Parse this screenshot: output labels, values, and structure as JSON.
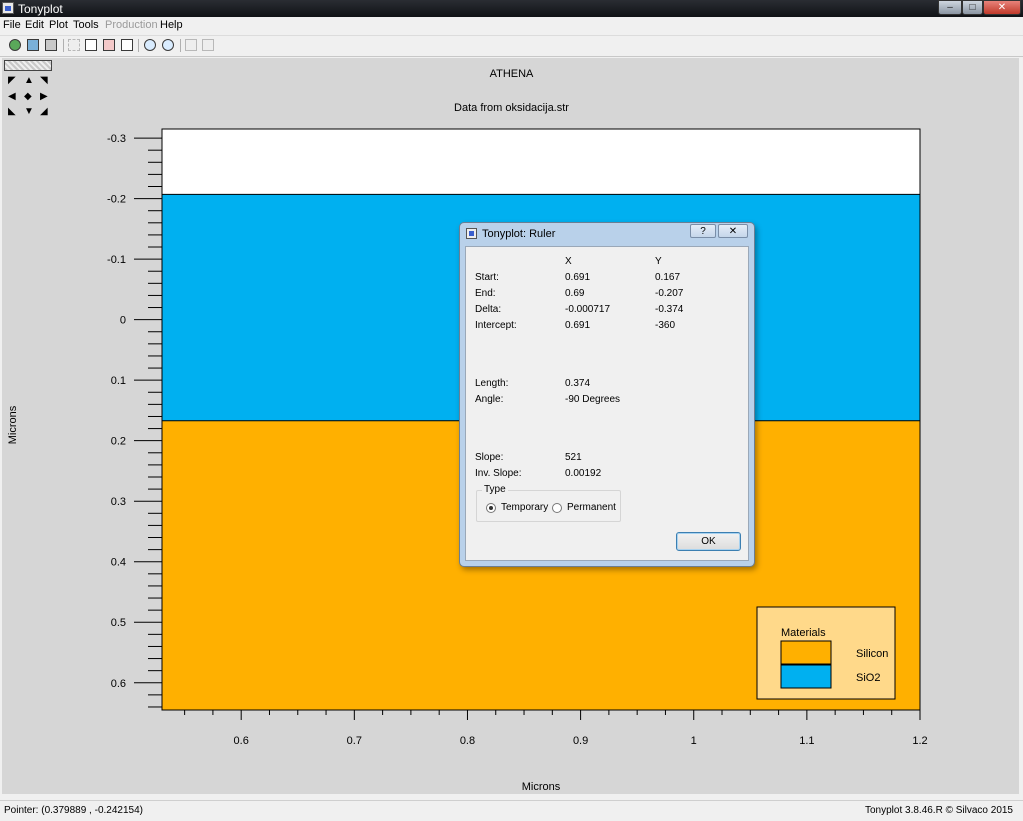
{
  "window": {
    "title": "Tonyplot"
  },
  "menu": [
    {
      "label": "File",
      "enabled": true
    },
    {
      "label": "Edit",
      "enabled": true
    },
    {
      "label": "Plot",
      "enabled": true
    },
    {
      "label": "Tools",
      "enabled": true
    },
    {
      "label": "Production",
      "enabled": false
    },
    {
      "label": "Help",
      "enabled": true
    }
  ],
  "toolbar": {
    "icons": [
      "load-icon",
      "save-icon",
      "print-icon",
      "select-icon",
      "copy-icon",
      "paste-icon",
      "duplicate-icon",
      "zoom-in-icon",
      "zoom-out-icon",
      "zoom-fit-icon",
      "zoom-reset-icon"
    ]
  },
  "plot": {
    "title": "ATHENA",
    "subtitle": "Data from oksidacija.str"
  },
  "chart_data": {
    "type": "area",
    "xlabel": "Microns",
    "ylabel": "Microns",
    "xlim": [
      0.53,
      1.2
    ],
    "ylim": [
      -0.315,
      0.645
    ],
    "y_inverted": true,
    "x_ticks": [
      "0.6",
      "0.7",
      "0.8",
      "0.9",
      "1",
      "1.1",
      "1.2"
    ],
    "y_ticks": [
      "-0.3",
      "-0.2",
      "-0.1",
      "0",
      "0.1",
      "0.2",
      "0.3",
      "0.4",
      "0.5",
      "0.6"
    ],
    "regions": [
      {
        "material": "Air",
        "y_from": -0.315,
        "y_to": -0.207,
        "color": "#ffffff"
      },
      {
        "material": "SiO2",
        "y_from": -0.207,
        "y_to": 0.167,
        "color": "#00b0f0"
      },
      {
        "material": "Silicon",
        "y_from": 0.167,
        "y_to": 0.645,
        "color": "#ffb000"
      }
    ],
    "legend": {
      "title": "Materials",
      "position": "bottom-right",
      "entries": [
        {
          "name": "Silicon",
          "color": "#ffb000"
        },
        {
          "name": "SiO2",
          "color": "#00b0f0"
        }
      ]
    }
  },
  "ruler_dialog": {
    "title": "Tonyplot: Ruler",
    "help_label": "?",
    "close_label": "✕",
    "col_x": "X",
    "col_y": "Y",
    "rows": [
      {
        "label": "Start:",
        "x": "0.691",
        "y": "0.167"
      },
      {
        "label": "End:",
        "x": "0.69",
        "y": "-0.207"
      },
      {
        "label": "Delta:",
        "x": "-0.000717",
        "y": "-0.374"
      },
      {
        "label": "Intercept:",
        "x": "0.691",
        "y": "-360"
      }
    ],
    "length_label": "Length:",
    "length_value": "0.374",
    "angle_label": "Angle:",
    "angle_value": "-90 Degrees",
    "slope_label": "Slope:",
    "slope_value": "521",
    "inv_slope_label": "Inv. Slope:",
    "inv_slope_value": "0.00192",
    "type_label": "Type",
    "type_options": [
      "Temporary",
      "Permanent"
    ],
    "type_selected": "Temporary",
    "ok_label": "OK"
  },
  "status": {
    "pointer": "Pointer: (0.379889 , -0.242154)",
    "version": "Tonyplot 3.8.46.R © Silvaco 2015"
  },
  "colors": {
    "air": "#ffffff",
    "sio2": "#00b0f0",
    "silicon": "#ffb000",
    "legend_bg": "#ffd98a",
    "plot_bg": "#d6d6d6"
  }
}
